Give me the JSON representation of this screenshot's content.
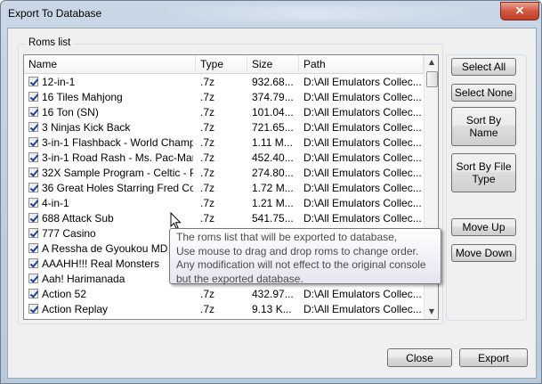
{
  "window": {
    "title": "Export To Database",
    "close_glyph": "×"
  },
  "roms": {
    "group_label": "Roms list",
    "columns": [
      "Name",
      "Type",
      "Size",
      "Path"
    ],
    "rows": [
      {
        "name": "12-in-1",
        "type": ".7z",
        "size": "932.68...",
        "path": "D:\\All Emulators Collec...",
        "checked": true
      },
      {
        "name": "16 Tiles Mahjong",
        "type": ".7z",
        "size": "374.79...",
        "path": "D:\\All Emulators Collec...",
        "checked": true
      },
      {
        "name": "16 Ton (SN)",
        "type": ".7z",
        "size": "101.04...",
        "path": "D:\\All Emulators Collec...",
        "checked": true
      },
      {
        "name": "3 Ninjas Kick Back",
        "type": ".7z",
        "size": "721.65...",
        "path": "D:\\All Emulators Collec...",
        "checked": true
      },
      {
        "name": "3-in-1 Flashback - World Champ....",
        "type": ".7z",
        "size": "1.11 M...",
        "path": "D:\\All Emulators Collec...",
        "checked": true
      },
      {
        "name": "3-in-1 Road Rash - Ms. Pac-Man....",
        "type": ".7z",
        "size": "452.40...",
        "path": "D:\\All Emulators Collec...",
        "checked": true
      },
      {
        "name": "32X Sample Program - Celtic - P...",
        "type": ".7z",
        "size": "274.80...",
        "path": "D:\\All Emulators Collec...",
        "checked": true
      },
      {
        "name": "36 Great Holes Starring Fred Co...",
        "type": ".7z",
        "size": "1.72 M...",
        "path": "D:\\All Emulators Collec...",
        "checked": true
      },
      {
        "name": "4-in-1",
        "type": ".7z",
        "size": "1.21 M...",
        "path": "D:\\All Emulators Collec...",
        "checked": true
      },
      {
        "name": "688 Attack Sub",
        "type": ".7z",
        "size": "541.75...",
        "path": "D:\\All Emulators Collec...",
        "checked": true
      },
      {
        "name": "777 Casino",
        "type": "",
        "size": "",
        "path": "",
        "checked": true
      },
      {
        "name": "A Ressha de Gyoukou MD",
        "type": "",
        "size": "",
        "path": "",
        "checked": true
      },
      {
        "name": "AAAHH!!! Real Monsters",
        "type": "",
        "size": "",
        "path": "",
        "checked": true
      },
      {
        "name": "Aah! Harimanada",
        "type": "",
        "size": "",
        "path": "",
        "checked": true
      },
      {
        "name": "Action 52",
        "type": ".7z",
        "size": "432.97...",
        "path": "D:\\All Emulators Collec...",
        "checked": true
      },
      {
        "name": "Action Replay",
        "type": ".7z",
        "size": "9.13 K...",
        "path": "D:\\All Emulators Collec...",
        "checked": true
      }
    ]
  },
  "buttons": {
    "select_all": "Select All",
    "select_none": "Select None",
    "sort_by_name": "Sort By Name",
    "sort_by_file_type": "Sort By File Type",
    "move_up": "Move Up",
    "move_down": "Move Down",
    "close": "Close",
    "export": "Export"
  },
  "tooltip": {
    "lines": [
      "The roms list that will be exported to database,",
      "Use mouse to drag and drop roms to change order.",
      "Any modification will not effect to the original console",
      "but the exported database."
    ]
  },
  "scrollbar": {
    "up_glyph": "▲",
    "down_glyph": "▼"
  }
}
